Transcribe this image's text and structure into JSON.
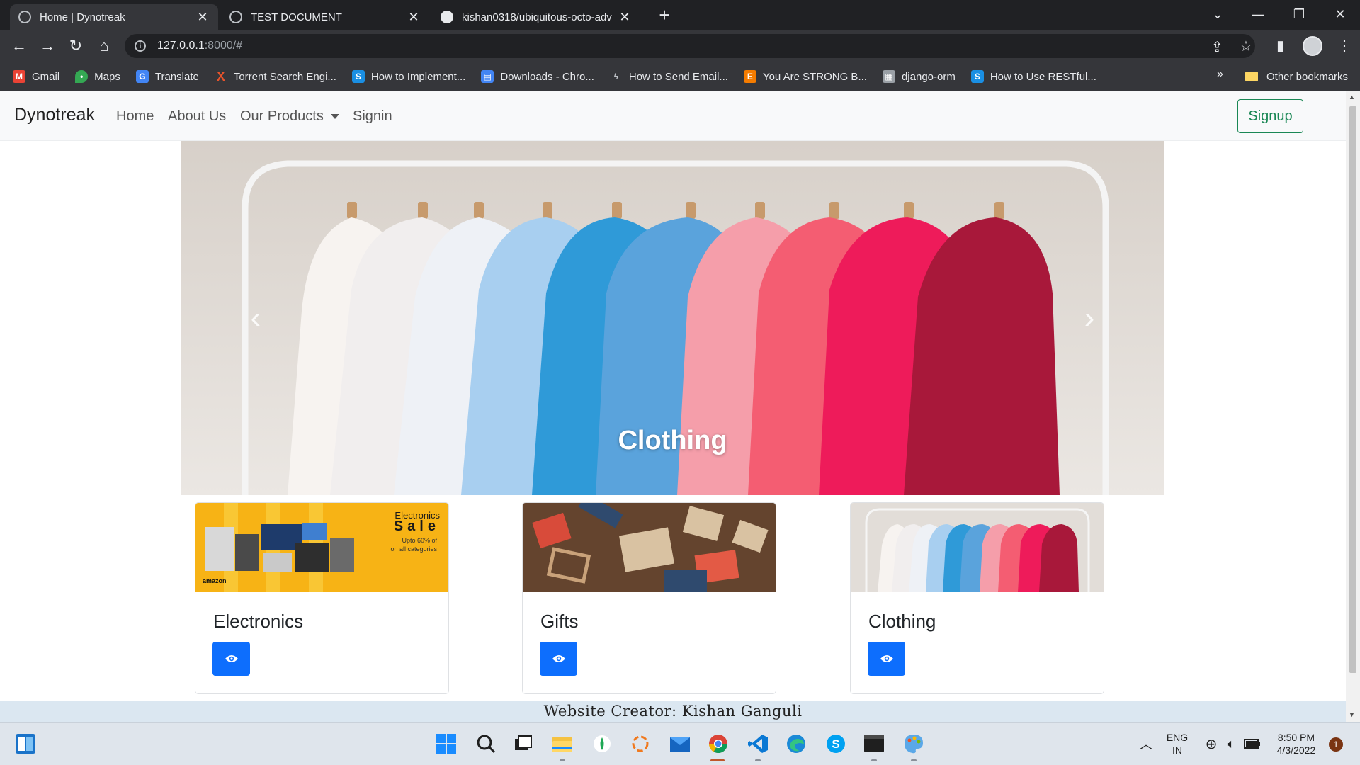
{
  "browser": {
    "tabs": [
      {
        "title": "Home | Dynotreak",
        "active": true,
        "icon": "globe-icon"
      },
      {
        "title": "TEST DOCUMENT",
        "active": false,
        "icon": "globe-icon"
      },
      {
        "title": "kishan0318/ubiquitous-octo-adv",
        "active": false,
        "icon": "github-icon"
      }
    ],
    "url_host": "127.0.0.1",
    "url_rest": ":8000/#",
    "bookmarks": [
      {
        "label": "Gmail",
        "icon": "gmail-icon",
        "color": "#ea4335"
      },
      {
        "label": "Maps",
        "icon": "maps-icon",
        "color": "#34a853"
      },
      {
        "label": "Translate",
        "icon": "translate-icon",
        "color": "#4285f4"
      },
      {
        "label": "Torrent Search Engi...",
        "icon": "torrent-icon",
        "color": "#e8542b"
      },
      {
        "label": "How to Implement...",
        "icon": "s-icon",
        "color": "#1a8fe3"
      },
      {
        "label": "Downloads - Chro...",
        "icon": "downloads-icon",
        "color": "#4285f4"
      },
      {
        "label": "How to Send Email...",
        "icon": "link-icon",
        "color": "#9aa0a6"
      },
      {
        "label": "You Are STRONG B...",
        "icon": "e-icon",
        "color": "#f57c00"
      },
      {
        "label": "django-orm",
        "icon": "doc-icon",
        "color": "#9aa0a6"
      },
      {
        "label": "How to Use RESTful...",
        "icon": "s-icon",
        "color": "#1a8fe3"
      }
    ],
    "more_bookmarks": "»",
    "other_bookmarks": "Other bookmarks"
  },
  "site": {
    "brand": "Dynotreak",
    "nav": {
      "home": "Home",
      "about": "About Us",
      "products": "Our Products",
      "signin": "Signin"
    },
    "signup": "Signup",
    "carousel_caption": "Clothing",
    "cards": [
      {
        "title": "Electronics",
        "image": "electronics-sale-banner",
        "banner_line1": "Electronics",
        "banner_line2": "Sale",
        "banner_line3": "Upto 60% of",
        "banner_line4": "on all categories",
        "banner_brand": "amazon"
      },
      {
        "title": "Gifts",
        "image": "gifts-photo"
      },
      {
        "title": "Clothing",
        "image": "clothing-photo"
      }
    ],
    "footer": "Website Creator: Kishan Ganguli"
  },
  "taskbar": {
    "lang_top": "ENG",
    "lang_bottom": "IN",
    "time": "8:50 PM",
    "date": "4/3/2022",
    "notification_count": "1"
  },
  "colors": {
    "primary_button": "#0d6efd",
    "signup_outline": "#198754",
    "footer_bg": "#dbe7f1"
  }
}
